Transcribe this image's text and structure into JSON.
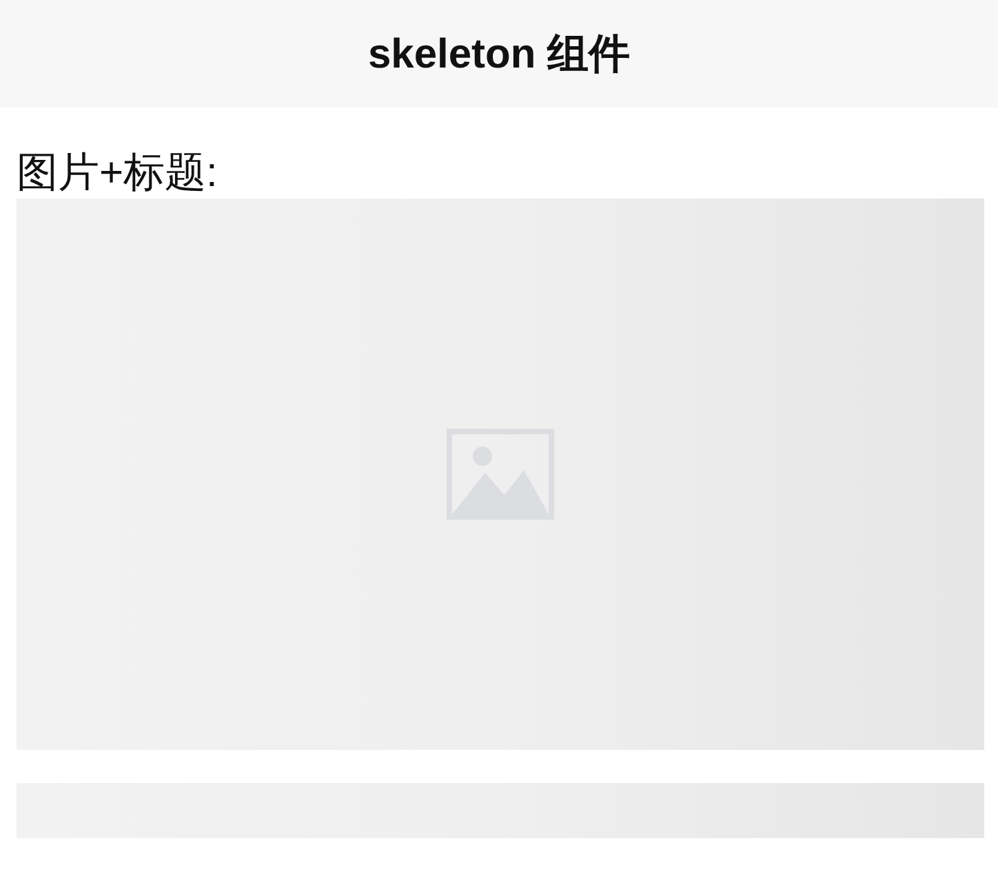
{
  "header": {
    "title": "skeleton 组件"
  },
  "section": {
    "label": "图片+标题:"
  },
  "skeleton": [
    {
      "kind": "image"
    },
    {
      "kind": "title"
    }
  ]
}
